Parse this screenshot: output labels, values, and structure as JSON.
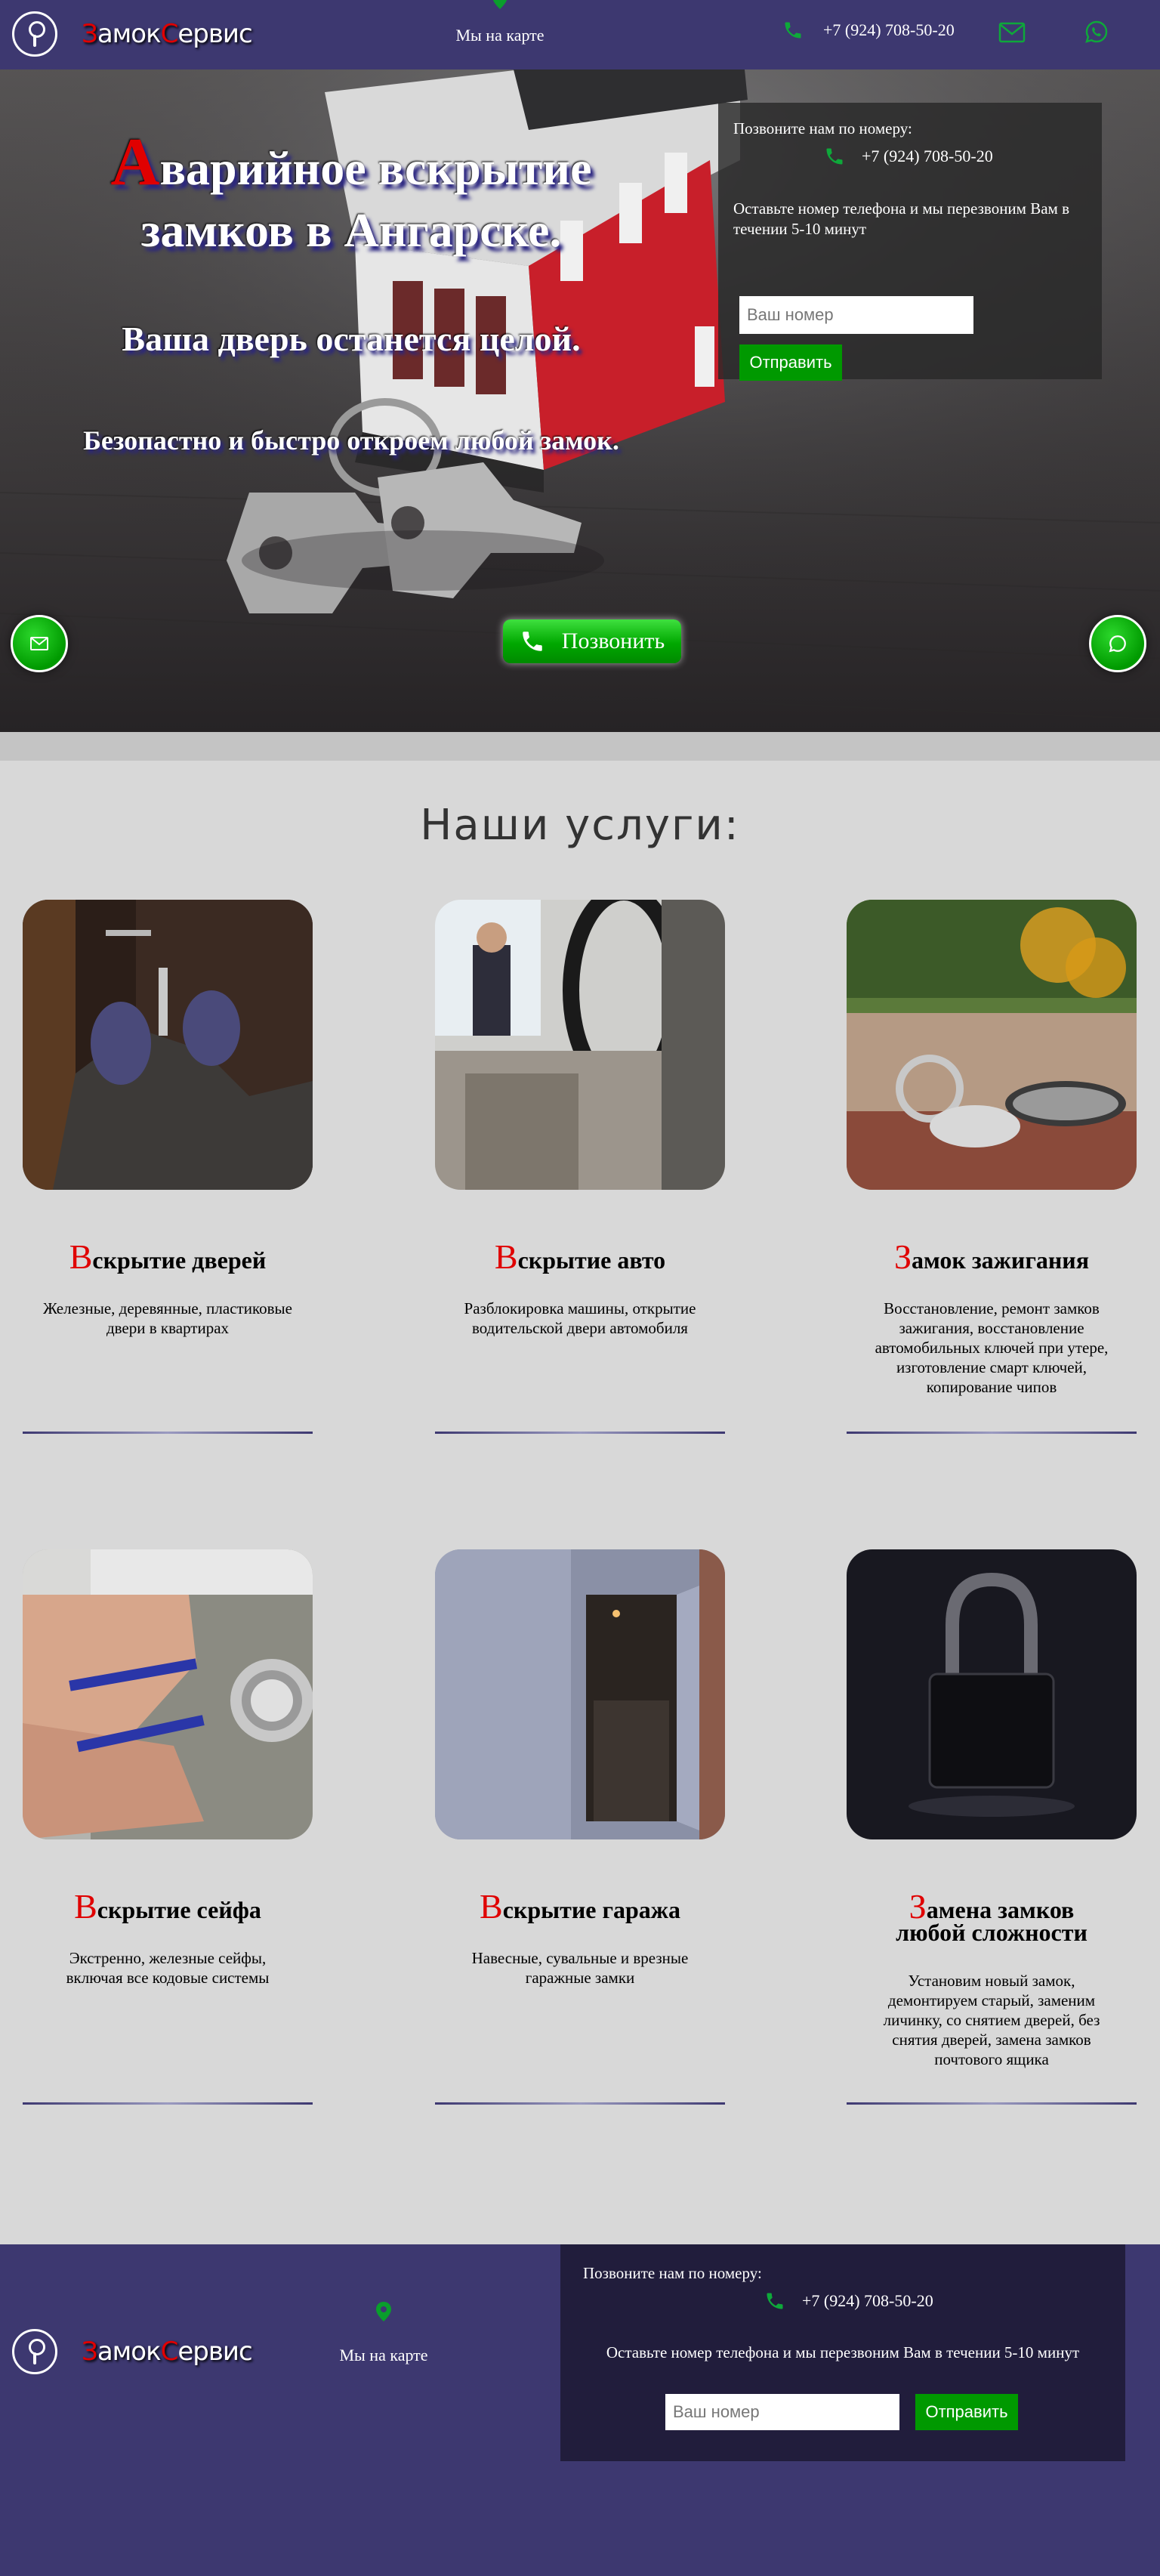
{
  "header": {
    "logo": {
      "first_letter": "З",
      "part1": "амок",
      "second_letter": "С",
      "part2": "ервис"
    },
    "map_label": "Мы на карте",
    "phone": "+7 (924) 708-50-20",
    "mail_icon": "mail-icon",
    "whatsapp_icon": "whatsapp-icon"
  },
  "hero": {
    "title_first_letter": "А",
    "title_rest_line1": "варийное вскрытие",
    "title_line2": "замков в Ангарске.",
    "subtitle": "Ваша дверь останется целой.",
    "subtitle2": "Безопастно и быстро откроем любой замок.",
    "form": {
      "call_label": "Позвоните нам по номеру:",
      "phone": "+7 (924) 708-50-20",
      "callback_text": "Оставьте номер телефона и мы перезвоним Вам в течении 5-10 минут",
      "input_placeholder": "Ваш номер",
      "submit_label": "Отправить"
    },
    "call_button_label": "Позвонить"
  },
  "services": {
    "title": "Наши услуги:",
    "items": [
      {
        "cap": "В",
        "title": "скрытие дверей",
        "title2": "",
        "desc": "Железные, деревянные, пластиковые двери в квартирах"
      },
      {
        "cap": "В",
        "title": "скрытие авто",
        "title2": "",
        "desc": "Разблокировка машины, открытие водительской двери автомобиля"
      },
      {
        "cap": "З",
        "title": "амок зажигания",
        "title2": "",
        "desc": "Восстановление, ремонт замков зажигания, восстановление автомобильных ключей при утере, изготовление смарт ключей, копирование чипов"
      },
      {
        "cap": "В",
        "title": "скрытие сейфа",
        "title2": "",
        "desc": "Экстренно, железные сейфы, включая все кодовые системы"
      },
      {
        "cap": "В",
        "title": "скрытие гаража",
        "title2": "",
        "desc": "Навесные, сувальные и врезные гаражные замки"
      },
      {
        "cap": "З",
        "title": "амена замков",
        "title2": "любой сложности",
        "desc": "Установим новый замок, демонтируем старый, заменим личинку, со снятием дверей, без снятия дверей, замена замков почтового ящика"
      }
    ]
  },
  "footer": {
    "map_label": "Мы на карте",
    "form": {
      "call_label": "Позвоните нам по номеру:",
      "phone": "+7 (924) 708-50-20",
      "callback_text": "Оставьте номер телефона и мы перезвоним Вам в течении 5-10 минут",
      "input_placeholder": "Ваш номер",
      "submit_label": "Отправить"
    }
  },
  "colors": {
    "header_bg": "#3d3870",
    "accent_red": "#e00000",
    "accent_green": "#009900",
    "page_bg": "#d8d8d8"
  }
}
